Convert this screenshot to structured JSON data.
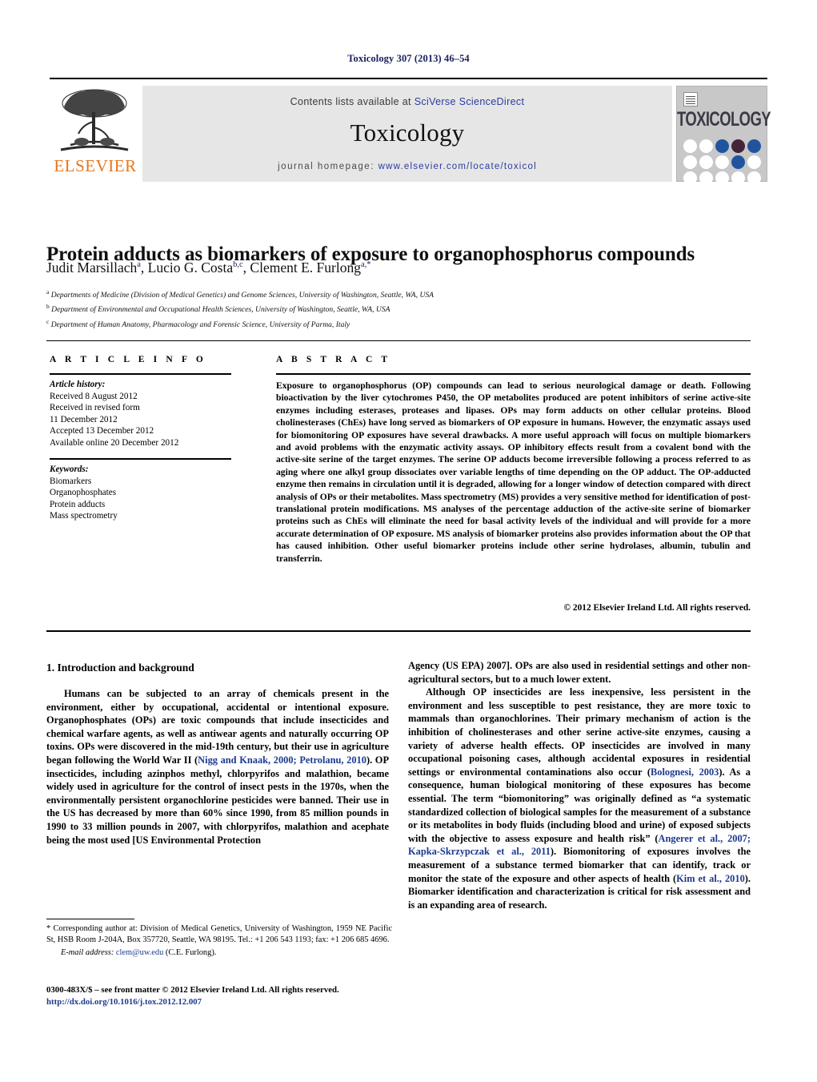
{
  "running_head": "Toxicology 307 (2013) 46–54",
  "masthead": {
    "contents_prefix": "Contents lists available at ",
    "contents_link": "SciVerse ScienceDirect",
    "journal_title": "Toxicology",
    "homepage_prefix": "journal homepage:",
    "homepage_url": "www.elsevier.com/locate/toxicol",
    "publisher_name": "ELSEVIER",
    "cover_word": "TOXICOLOGY",
    "accent_link_color": "#2b3c9e",
    "elsevier_orange": "#E8761B"
  },
  "article": {
    "title": "Protein adducts as biomarkers of exposure to organophosphorus compounds",
    "authors": [
      {
        "name": "Judit Marsillach",
        "sup": "a"
      },
      {
        "name": "Lucio G. Costa",
        "sup": "b,c"
      },
      {
        "name": "Clement E. Furlong",
        "sup": "a,*"
      }
    ],
    "affiliations": [
      {
        "mark": "a",
        "text": "Departments of Medicine (Division of Medical Genetics) and Genome Sciences, University of Washington, Seattle, WA, USA"
      },
      {
        "mark": "b",
        "text": "Department of Environmental and Occupational Health Sciences, University of Washington, Seattle, WA, USA"
      },
      {
        "mark": "c",
        "text": "Department of Human Anatomy, Pharmacology and Forensic Science, University of Parma, Italy"
      }
    ]
  },
  "article_info": {
    "heading": "A R T I C L E   I N F O",
    "history_label": "Article history:",
    "history": [
      "Received 8 August 2012",
      "Received in revised form",
      "11 December 2012",
      "Accepted 13 December 2012",
      "Available online 20 December 2012"
    ],
    "keywords_label": "Keywords:",
    "keywords": [
      "Biomarkers",
      "Organophosphates",
      "Protein adducts",
      "Mass spectrometry"
    ]
  },
  "abstract": {
    "heading": "A B S T R A C T",
    "body": "Exposure to organophosphorus (OP) compounds can lead to serious neurological damage or death. Following bioactivation by the liver cytochromes P450, the OP metabolites produced are potent inhibitors of serine active-site enzymes including esterases, proteases and lipases. OPs may form adducts on other cellular proteins. Blood cholinesterases (ChEs) have long served as biomarkers of OP exposure in humans. However, the enzymatic assays used for biomonitoring OP exposures have several drawbacks. A more useful approach will focus on multiple biomarkers and avoid problems with the enzymatic activity assays. OP inhibitory effects result from a covalent bond with the active-site serine of the target enzymes. The serine OP adducts become irreversible following a process referred to as aging where one alkyl group dissociates over variable lengths of time depending on the OP adduct. The OP-adducted enzyme then remains in circulation until it is degraded, allowing for a longer window of detection compared with direct analysis of OPs or their metabolites. Mass spectrometry (MS) provides a very sensitive method for identification of post-translational protein modifications. MS analyses of the percentage adduction of the active-site serine of biomarker proteins such as ChEs will eliminate the need for basal activity levels of the individual and will provide for a more accurate determination of OP exposure. MS analysis of biomarker proteins also provides information about the OP that has caused inhibition. Other useful biomarker proteins include other serine hydrolases, albumin, tubulin and transferrin.",
    "copyright": "© 2012 Elsevier Ireland Ltd. All rights reserved."
  },
  "body": {
    "section_heading": "1.  Introduction and background",
    "left_paragraphs": [
      {
        "parts": [
          {
            "t": "Humans can be subjected to an array of chemicals present in the environment, either by occupational, accidental or intentional exposure. Organophosphates (OPs) are toxic compounds that include insecticides and chemical warfare agents, as well as antiwear agents and naturally occurring OP toxins. OPs were discovered in the mid-19th century, but their use in agriculture began following the World War II ("
          },
          {
            "t": "Nigg and Knaak, 2000; Petrolanu, 2010",
            "ref": true
          },
          {
            "t": "). OP insecticides, including azinphos methyl, chlorpyrifos and malathion, became widely used in agriculture for the control of insect pests in the 1970s, when the environmentally persistent organochlorine pesticides were banned. Their use in the US has decreased by more than 60% since 1990, from 85 million pounds in 1990 to 33 million pounds in 2007, with chlorpyrifos, malathion and acephate being the most used [US Environmental Protection"
          }
        ]
      }
    ],
    "right_paragraphs": [
      {
        "indent": false,
        "parts": [
          {
            "t": "Agency (US EPA) 2007]. OPs are also used in residential settings and other non-agricultural sectors, but to a much lower extent."
          }
        ]
      },
      {
        "indent": true,
        "parts": [
          {
            "t": "Although OP insecticides are less inexpensive, less persistent in the environment and less susceptible to pest resistance, they are more toxic to mammals than organochlorines. Their primary mechanism of action is the inhibition of cholinesterases and other serine active-site enzymes, causing a variety of adverse health effects. OP insecticides are involved in many occupational poisoning cases, although accidental exposures in residential settings or environmental contaminations also occur ("
          },
          {
            "t": "Bolognesi, 2003",
            "ref": true
          },
          {
            "t": "). As a consequence, human biological monitoring of these exposures has become essential. The term “biomonitoring” was originally defined as “a systematic standardized collection of biological samples for the measurement of a substance or its metabolites in body fluids (including blood and urine) of exposed subjects with the objective to assess exposure and health risk” ("
          },
          {
            "t": "Angerer et al., 2007; Kapka-Skrzypczak et al., 2011",
            "ref": true
          },
          {
            "t": "). Biomonitoring of exposures involves the measurement of a substance termed biomarker that can identify, track or monitor the state of the exposure and other aspects of health ("
          },
          {
            "t": "Kim et al., 2010",
            "ref": true
          },
          {
            "t": "). Biomarker identification and characterization is critical for risk assessment and is an expanding area of research."
          }
        ]
      }
    ]
  },
  "footnotes": {
    "corresponding": "* Corresponding author at: Division of Medical Genetics, University of Washington, 1959 NE Pacific St, HSB Room J-204A, Box 357720, Seattle, WA 98195. Tel.: +1 206 543 1193; fax: +1 206 685 4696.",
    "email_label": "E-mail address:",
    "email": "clem@uw.edu",
    "email_suffix": " (C.E. Furlong).",
    "imprint": "0300-483X/$ – see front matter © 2012 Elsevier Ireland Ltd. All rights reserved.",
    "doi": "http://dx.doi.org/10.1016/j.tox.2012.12.007"
  }
}
